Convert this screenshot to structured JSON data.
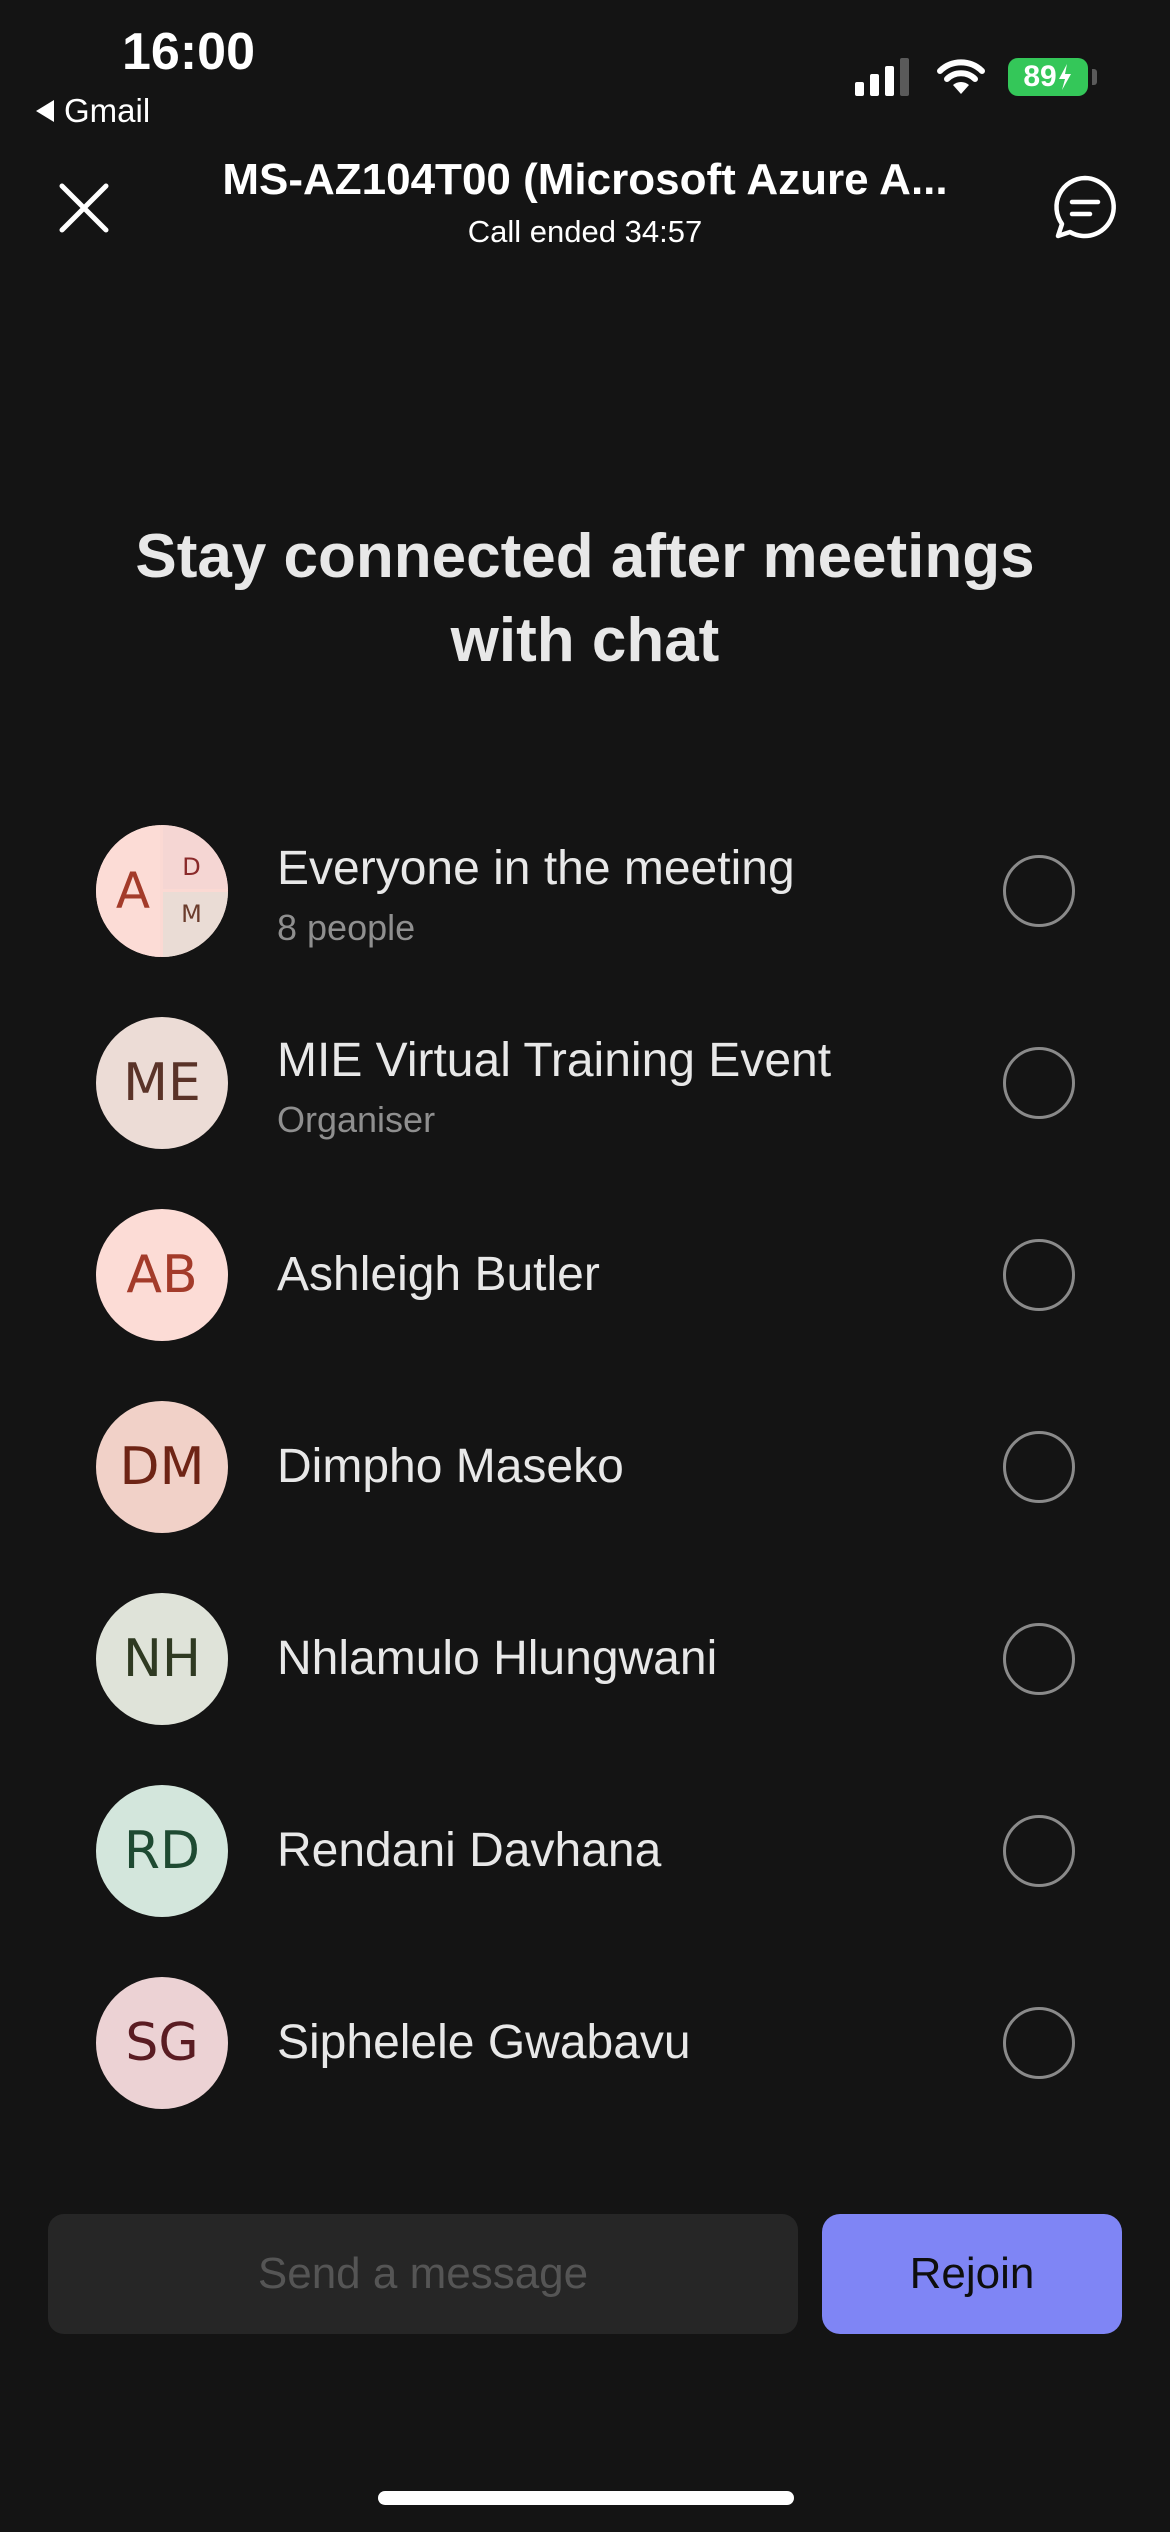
{
  "status_bar": {
    "time": "16:00",
    "back_app": "Gmail",
    "battery": "89"
  },
  "header": {
    "title": "MS-AZ104T00 (Microsoft Azure A...",
    "subtitle": "Call ended 34:57"
  },
  "heading": "Stay connected after meetings with chat",
  "participants": [
    {
      "name": "Everyone in the meeting",
      "sub": "8 people",
      "group_initials": [
        "A",
        "D",
        "M"
      ]
    },
    {
      "initials": "ME",
      "name": "MIE Virtual Training Event",
      "sub": "Organiser",
      "avatar_bg": "#ecdcd6",
      "avatar_fg": "#5a3328"
    },
    {
      "initials": "AB",
      "name": "Ashleigh Butler",
      "avatar_bg": "#fcdcd6",
      "avatar_fg": "#a33b2a"
    },
    {
      "initials": "DM",
      "name": "Dimpho Maseko",
      "avatar_bg": "#f1d1c8",
      "avatar_fg": "#6e2415"
    },
    {
      "initials": "NH",
      "name": "Nhlamulo Hlungwani",
      "avatar_bg": "#dfe3d9",
      "avatar_fg": "#2f3a22"
    },
    {
      "initials": "RD",
      "name": "Rendani Davhana",
      "avatar_bg": "#d3e6dc",
      "avatar_fg": "#1e4a32"
    },
    {
      "initials": "SG",
      "name": "Siphelele Gwabavu",
      "avatar_bg": "#ecd2d4",
      "avatar_fg": "#5a1c22"
    }
  ],
  "footer": {
    "message_placeholder": "Send a message",
    "rejoin_label": "Rejoin"
  },
  "colors": {
    "background": "#141414",
    "accent": "#7f85f5",
    "battery": "#34c759"
  }
}
